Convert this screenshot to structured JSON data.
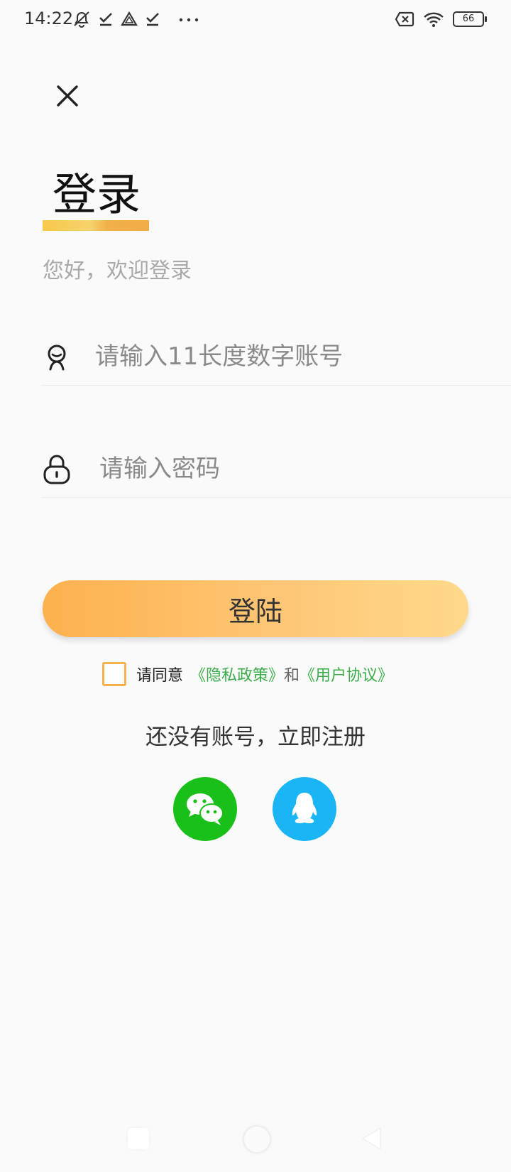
{
  "status_bar": {
    "time": "14:22",
    "battery": "66",
    "icons_left": [
      "mute-icon",
      "check-icon",
      "drive-icon",
      "check-icon",
      "more-icon"
    ],
    "icons_right": [
      "sim-off-icon",
      "wifi-icon",
      "battery-icon"
    ]
  },
  "header": {
    "close_icon": "close-icon",
    "title": "登录",
    "subtitle": "您好，欢迎登录"
  },
  "form": {
    "account": {
      "icon": "user-icon",
      "value": "",
      "placeholder": "请输入11长度数字账号"
    },
    "password": {
      "icon": "lock-icon",
      "value": "",
      "placeholder": "请输入密码"
    },
    "login_label": "登陆"
  },
  "agreement": {
    "prefix": "请同意",
    "privacy_link": "《隐私政策》",
    "and": "和",
    "user_link": "《用户协议》"
  },
  "register_text": "还没有账号，立即注册",
  "social": {
    "wechat_icon": "wechat-icon",
    "qq_icon": "qq-icon"
  },
  "colors": {
    "accent": "#fdb14d",
    "link": "#3cad4a",
    "wechat": "#18c019",
    "qq": "#1ab5f5"
  }
}
